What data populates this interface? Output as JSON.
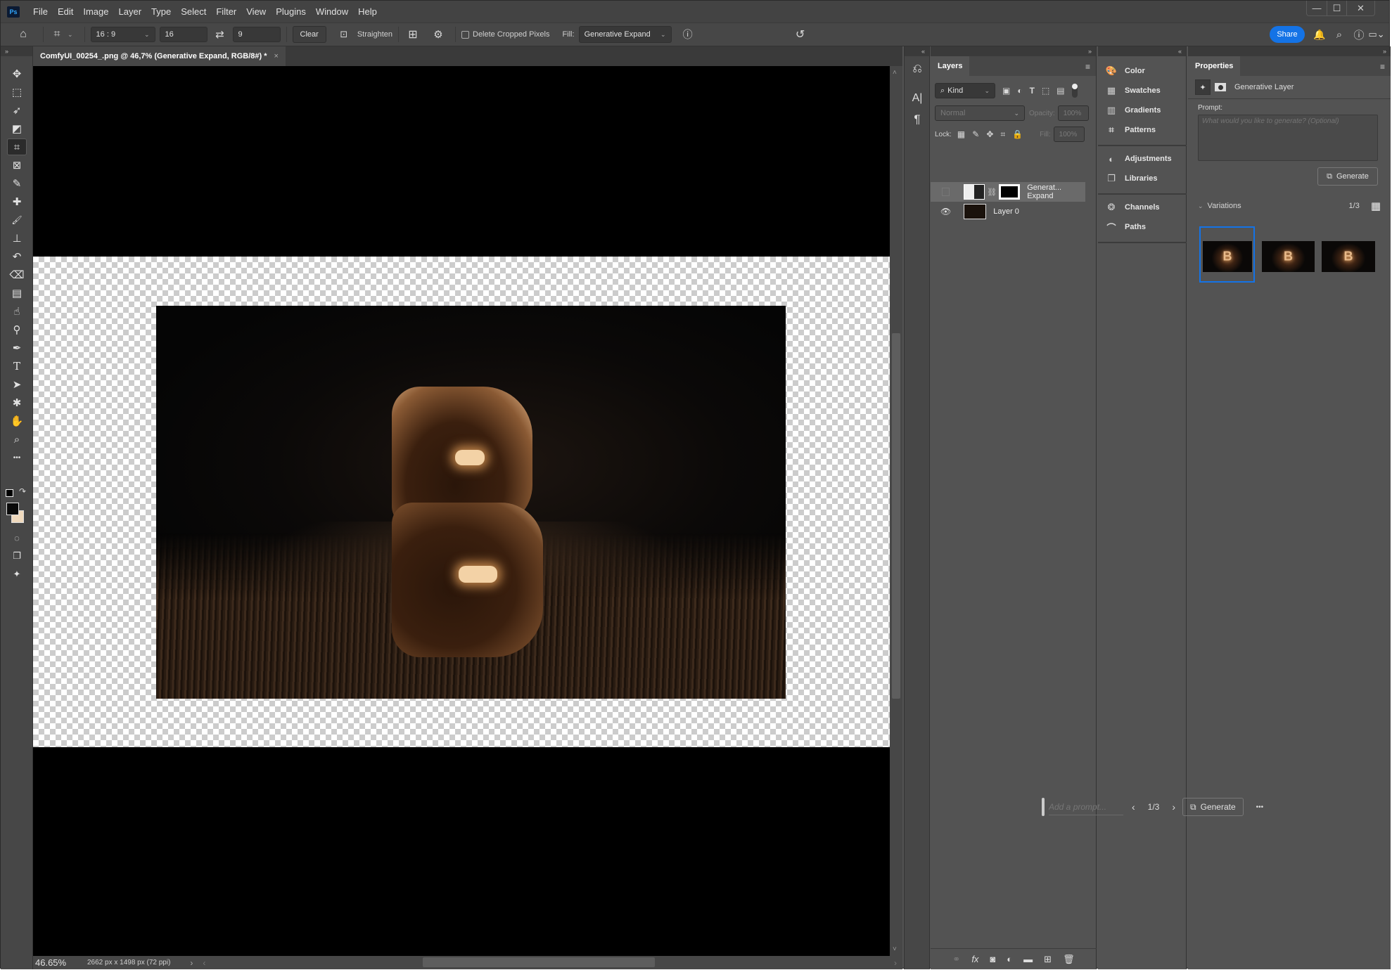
{
  "app": {
    "logo": "Ps",
    "menu": [
      "File",
      "Edit",
      "Image",
      "Layer",
      "Type",
      "Select",
      "Filter",
      "View",
      "Plugins",
      "Window",
      "Help"
    ],
    "window_controls": {
      "minimize": "—",
      "maximize": "☐",
      "close": "✕"
    }
  },
  "options_bar": {
    "ratio_preset": "16 : 9",
    "width_value": "16",
    "height_value": "9",
    "clear_label": "Clear",
    "straighten_label": "Straighten",
    "delete_cropped_label": "Delete Cropped Pixels",
    "delete_cropped_checked": false,
    "fill_label": "Fill:",
    "fill_value": "Generative Expand",
    "share_label": "Share"
  },
  "document": {
    "tab_title": "ComfyUI_00254_.png @ 46,7% (Generative Expand, RGB/8#) *",
    "close_glyph": "×"
  },
  "status_bar": {
    "zoom": "46.65%",
    "doc_info": "2662 px x 1498 px (72 ppi)"
  },
  "tools": [
    {
      "name": "move",
      "glyph": "✥"
    },
    {
      "name": "marquee",
      "glyph": "⬚"
    },
    {
      "name": "lasso",
      "glyph": "➶"
    },
    {
      "name": "object-selection",
      "glyph": "◩"
    },
    {
      "name": "crop",
      "glyph": "⌗",
      "active": true
    },
    {
      "name": "frame",
      "glyph": "⊠"
    },
    {
      "name": "eyedropper",
      "glyph": "✎"
    },
    {
      "name": "healing-brush",
      "glyph": "✚"
    },
    {
      "name": "brush",
      "glyph": "🖌"
    },
    {
      "name": "clone-stamp",
      "glyph": "⊥"
    },
    {
      "name": "history-brush",
      "glyph": "↶"
    },
    {
      "name": "eraser",
      "glyph": "⌫"
    },
    {
      "name": "gradient",
      "glyph": "▤"
    },
    {
      "name": "smudge",
      "glyph": "☝"
    },
    {
      "name": "dodge",
      "glyph": "⚲"
    },
    {
      "name": "pen",
      "glyph": "✒"
    },
    {
      "name": "type",
      "glyph": "T"
    },
    {
      "name": "path-selection",
      "glyph": "➤"
    },
    {
      "name": "custom-shape",
      "glyph": "✱"
    },
    {
      "name": "hand",
      "glyph": "✋"
    },
    {
      "name": "zoom",
      "glyph": "⌕"
    },
    {
      "name": "more-tools",
      "glyph": "•••"
    }
  ],
  "colors": {
    "foreground": "#0a0a0a",
    "background": "#efd9bd",
    "accent": "#1473e6"
  },
  "layers_panel": {
    "tab": "Layers",
    "filter_kind": "Kind",
    "blend_mode": "Normal",
    "opacity_label": "Opacity:",
    "opacity_value": "100%",
    "lock_label": "Lock:",
    "fill_label": "Fill:",
    "fill_value": "100%",
    "layers": [
      {
        "name": "Generat... Expand",
        "visible": false,
        "selected": true
      },
      {
        "name": "Layer 0",
        "visible": true,
        "selected": false
      }
    ]
  },
  "mini_panels": {
    "group1": [
      {
        "label": "Color",
        "icon": "palette-icon"
      },
      {
        "label": "Swatches",
        "icon": "swatches-icon"
      },
      {
        "label": "Gradients",
        "icon": "gradients-icon"
      },
      {
        "label": "Patterns",
        "icon": "patterns-icon"
      }
    ],
    "group2": [
      {
        "label": "Adjustments",
        "icon": "adjustments-icon"
      },
      {
        "label": "Libraries",
        "icon": "libraries-icon"
      }
    ],
    "group3": [
      {
        "label": "Channels",
        "icon": "channels-icon"
      },
      {
        "label": "Paths",
        "icon": "paths-icon"
      }
    ]
  },
  "properties_panel": {
    "tab": "Properties",
    "layer_type": "Generative Layer",
    "prompt_label": "Prompt:",
    "prompt_placeholder": "What would you like to generate? (Optional)",
    "generate_label": "Generate",
    "variations_label": "Variations",
    "variations_count": "1/3",
    "variations": [
      {
        "label": "B",
        "selected": true
      },
      {
        "label": "B",
        "selected": false
      },
      {
        "label": "B",
        "selected": false
      }
    ]
  },
  "contextual_taskbar": {
    "prompt_placeholder": "Add a prompt...",
    "counter": "1/3",
    "generate_label": "Generate",
    "more": "•••"
  }
}
